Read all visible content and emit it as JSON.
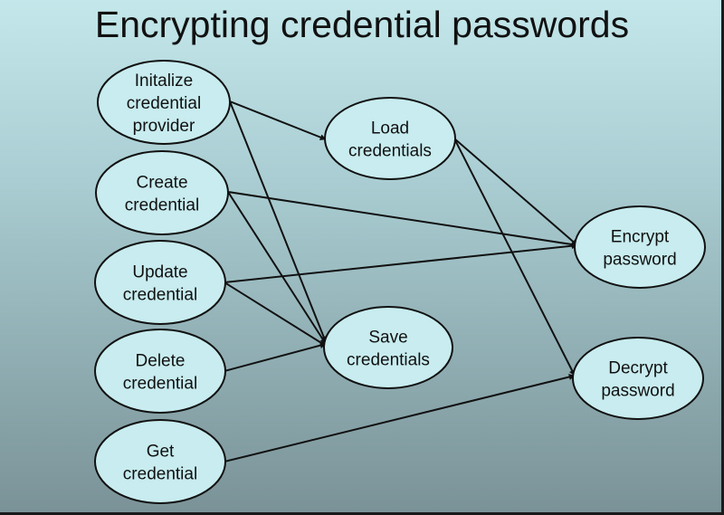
{
  "title": "Encrypting credential passwords",
  "nodes": [
    {
      "id": "init",
      "lines": [
        "Initalize",
        "credential",
        "provider"
      ]
    },
    {
      "id": "create",
      "lines": [
        "Create",
        "credential"
      ]
    },
    {
      "id": "update",
      "lines": [
        "Update",
        "credential"
      ]
    },
    {
      "id": "delete",
      "lines": [
        "Delete",
        "credential"
      ]
    },
    {
      "id": "get",
      "lines": [
        "Get",
        "credential"
      ]
    },
    {
      "id": "load",
      "lines": [
        "Load",
        "credentials"
      ]
    },
    {
      "id": "save",
      "lines": [
        "Save",
        "credentials"
      ]
    },
    {
      "id": "encrypt",
      "lines": [
        "Encrypt",
        "password"
      ]
    },
    {
      "id": "decrypt",
      "lines": [
        "Decrypt",
        "password"
      ]
    }
  ],
  "edges": [
    {
      "from": "init",
      "to": "load"
    },
    {
      "from": "init",
      "to": "save"
    },
    {
      "from": "create",
      "to": "save"
    },
    {
      "from": "create",
      "to": "encrypt"
    },
    {
      "from": "update",
      "to": "save"
    },
    {
      "from": "update",
      "to": "encrypt"
    },
    {
      "from": "delete",
      "to": "save"
    },
    {
      "from": "get",
      "to": "decrypt"
    },
    {
      "from": "load",
      "to": "encrypt"
    },
    {
      "from": "load",
      "to": "decrypt"
    }
  ]
}
